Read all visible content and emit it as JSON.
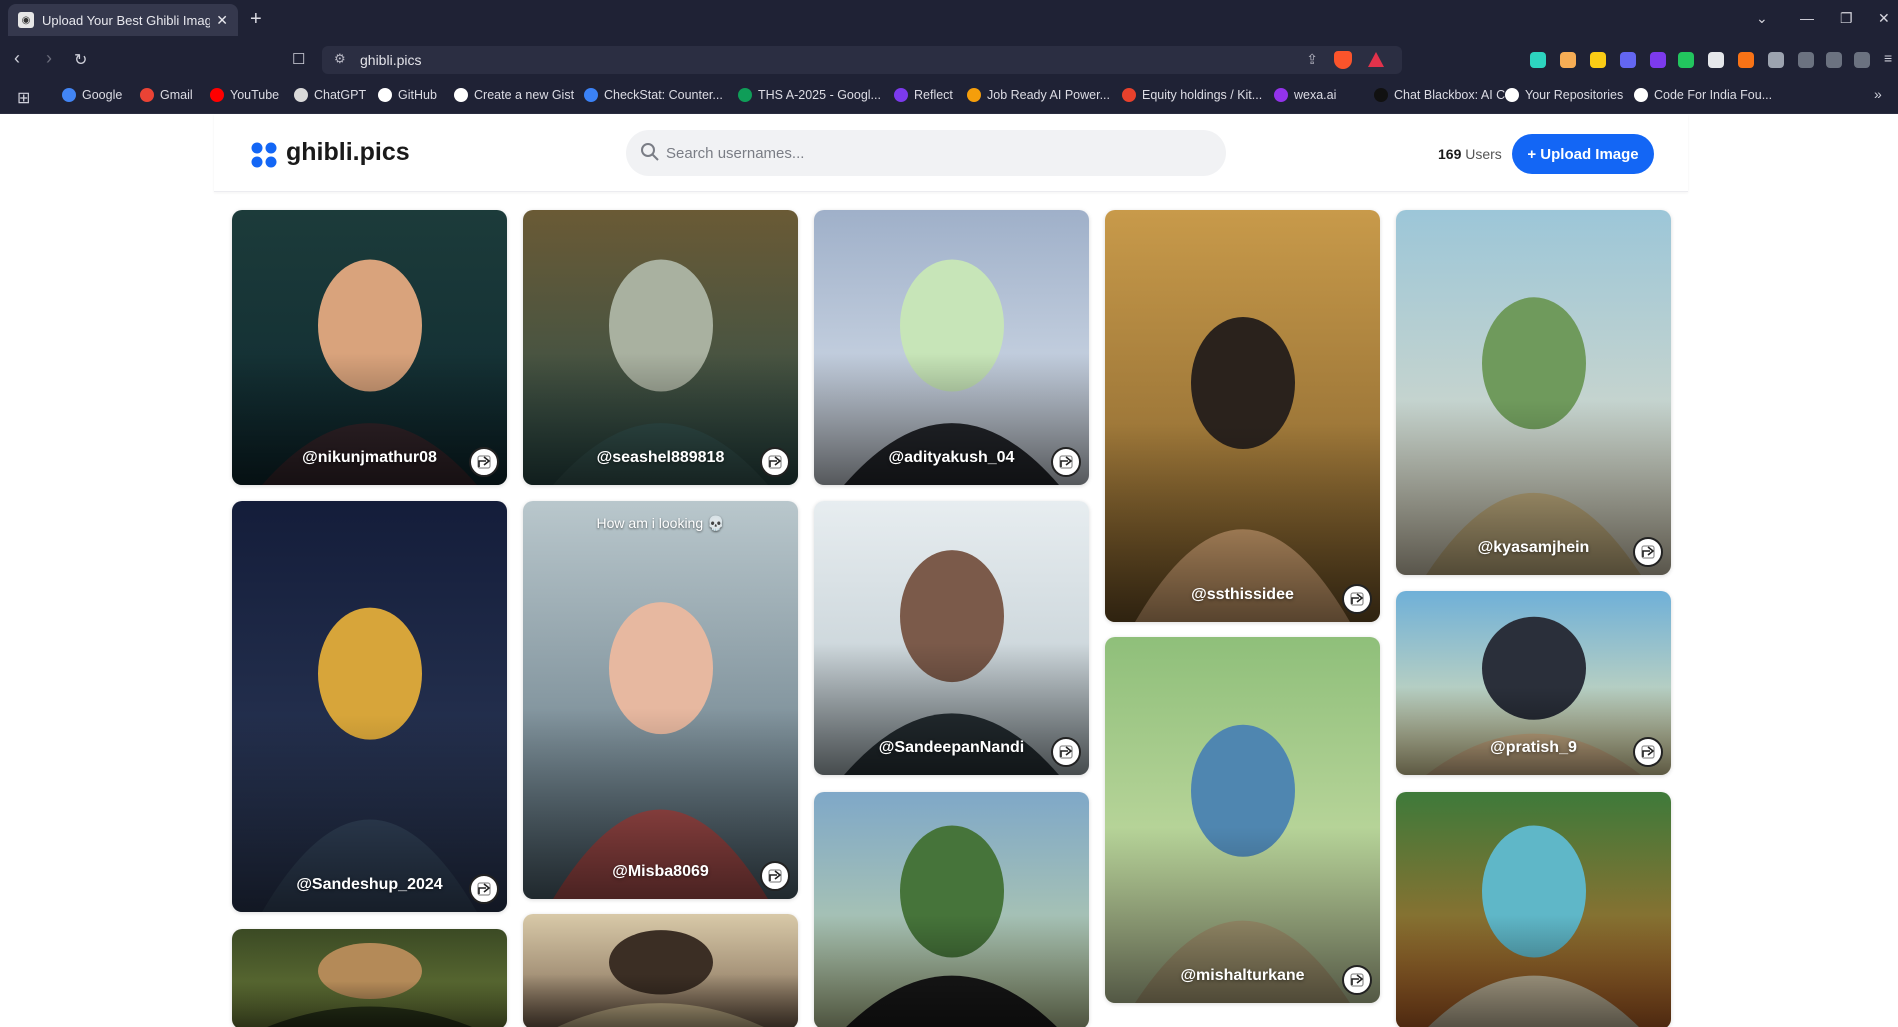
{
  "browser": {
    "tab_title": "Upload Your Best Ghibli Images",
    "new_tab": "+",
    "url": "ghibli.pics",
    "bookmarks": [
      {
        "label": "Google",
        "icon": "google-icon",
        "color": "#4285f4"
      },
      {
        "label": "Gmail",
        "icon": "gmail-icon",
        "color": "#ea4335"
      },
      {
        "label": "YouTube",
        "icon": "youtube-icon",
        "color": "#ff0000"
      },
      {
        "label": "ChatGPT",
        "icon": "chatgpt-icon",
        "color": "#d9d9d9"
      },
      {
        "label": "GitHub",
        "icon": "github-icon",
        "color": "#ffffff"
      },
      {
        "label": "Create a new Gist",
        "icon": "github-icon",
        "color": "#ffffff"
      },
      {
        "label": "CheckStat: Counter...",
        "icon": "checkstat-icon",
        "color": "#3b82f6"
      },
      {
        "label": "THS A-2025 - Googl...",
        "icon": "sheets-icon",
        "color": "#0f9d58"
      },
      {
        "label": "Reflect",
        "icon": "reflect-icon",
        "color": "#7c3aed"
      },
      {
        "label": "Job Ready AI Power...",
        "icon": "jobready-icon",
        "color": "#f59e0b"
      },
      {
        "label": "Equity holdings / Kit...",
        "icon": "kite-icon",
        "color": "#e8412c"
      },
      {
        "label": "wexa.ai",
        "icon": "wexa-icon",
        "color": "#9333ea"
      },
      {
        "label": "Chat Blackbox: AI C...",
        "icon": "blackbox-icon",
        "color": "#111111"
      },
      {
        "label": "Your Repositories",
        "icon": "github-icon",
        "color": "#ffffff"
      },
      {
        "label": "Code For India Fou...",
        "icon": "github-icon",
        "color": "#ffffff"
      }
    ]
  },
  "site": {
    "logo": "ghibli.pics",
    "search_placeholder": "Search usernames...",
    "user_count": "169",
    "user_label": "Users",
    "upload_label": "+ Upload Image",
    "accent": "#1366f5"
  },
  "cards": [
    {
      "username": "@nikunjmathur08"
    },
    {
      "username": "@Sandeshup_2024"
    },
    {
      "username": ""
    },
    {
      "username": "@seashel889818"
    },
    {
      "username": "@Misba8069",
      "caption": "How am i looking 💀"
    },
    {
      "username": ""
    },
    {
      "username": "@adityakush_04"
    },
    {
      "username": "@SandeepanNandi"
    },
    {
      "username": ""
    },
    {
      "username": "@ssthissidee"
    },
    {
      "username": "@mishalturkane"
    },
    {
      "username": "@kyasamjhein"
    },
    {
      "username": "@pratish_9"
    },
    {
      "username": ""
    }
  ]
}
